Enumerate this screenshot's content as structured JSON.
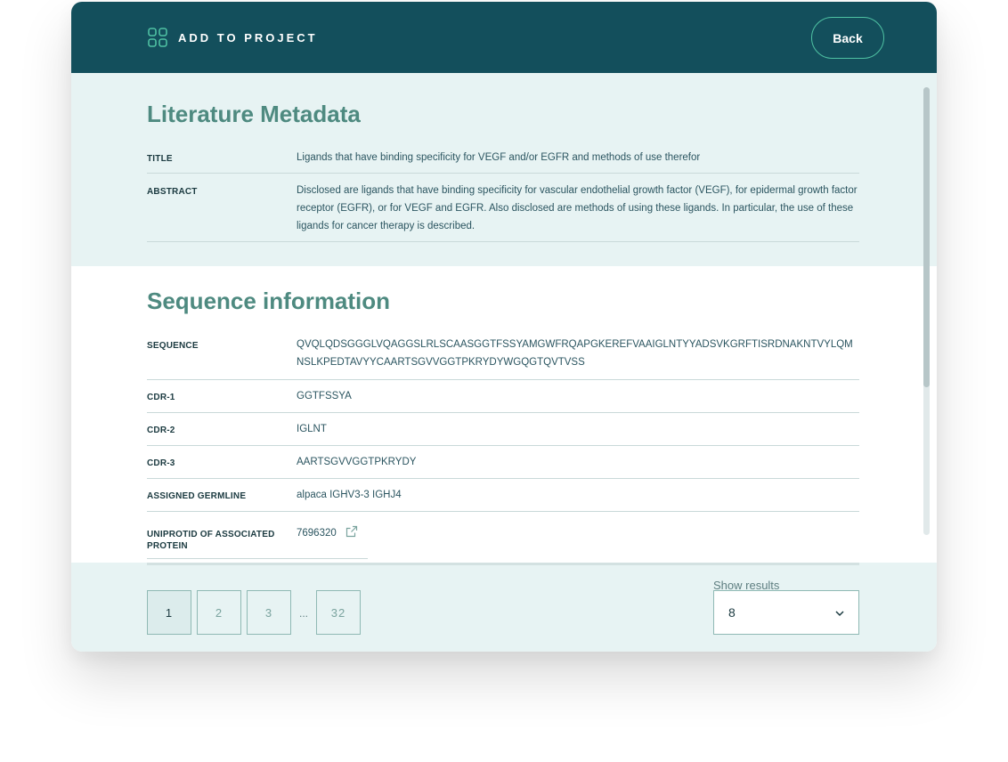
{
  "header": {
    "title": "ADD TO PROJECT",
    "back_label": "Back",
    "icon": "grid-icon"
  },
  "literature": {
    "heading": "Literature Metadata",
    "title_label": "TITLE",
    "title_value": "Ligands that have binding specificity for VEGF and/or EGFR and methods of use therefor",
    "abstract_label": "ABSTRACT",
    "abstract_value": "Disclosed are ligands that have binding specificity for vascular endothelial growth factor (VEGF), for epidermal growth factor receptor (EGFR), or for VEGF and EGFR. Also disclosed are methods of using these ligands. In particular, the use of these ligands for cancer therapy is described."
  },
  "sequence_info": {
    "heading": "Sequence information",
    "rows": [
      {
        "label": "SEQUENCE",
        "value": "QVQLQDSGGGLVQAGGSLRLSCAASGGTFSSYAMGWFRQAPGKEREFVAAIGLNTYYADSVKGRFTISRDNAKNTVYLQMNSLKPEDTAVYYCAARTSGVVGGTPKRYDYWGQGTQVTVSS"
      },
      {
        "label": "CDR-1",
        "value": "GGTFSSYA"
      },
      {
        "label": "CDR-2",
        "value": "IGLNT"
      },
      {
        "label": "CDR-3",
        "value": "AARTSGVVGGTPKRYDY"
      },
      {
        "label": "ASSIGNED GERMLINE",
        "value": "alpaca IGHV3-3 IGHJ4"
      },
      {
        "label": "UNIPROTID OF ASSOCIATED PROTEIN",
        "value": "7696320",
        "icon": "external-link-icon"
      }
    ]
  },
  "pagination": {
    "pages": [
      "1",
      "2",
      "3",
      "32"
    ],
    "ellipsis": "...",
    "current": "1"
  },
  "results": {
    "label": "Show results",
    "selected": "8"
  },
  "colors": {
    "header_bg": "#134f5c",
    "accent": "#4fc2a3",
    "heading": "#4e8a80",
    "panel_bg": "#e7f3f3"
  }
}
